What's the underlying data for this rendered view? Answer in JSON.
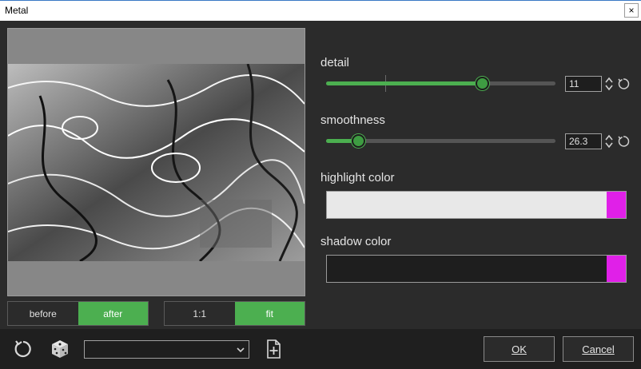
{
  "window": {
    "title": "Metal",
    "close_glyph": "×"
  },
  "preview": {
    "view_toggle": [
      {
        "label": "before",
        "active": false
      },
      {
        "label": "after",
        "active": true
      }
    ],
    "zoom_toggle": [
      {
        "label": "1:1",
        "active": false
      },
      {
        "label": "fit",
        "active": true
      }
    ]
  },
  "params": {
    "detail": {
      "label": "detail",
      "value": "11",
      "fraction": 0.68
    },
    "smoothness": {
      "label": "smoothness",
      "value": "26.3",
      "fraction": 0.14
    },
    "highlight": {
      "label": "highlight color",
      "color": "#e8e8e8",
      "picker": "#e020e8"
    },
    "shadow": {
      "label": "shadow color",
      "color": "#1e1e1e",
      "picker": "#e020e8"
    }
  },
  "footer": {
    "preset_value": "",
    "ok_label": "OK",
    "cancel_label": "Cancel",
    "icons": [
      "reset-icon",
      "dice-icon",
      "add-preset-icon"
    ]
  },
  "colors": {
    "accent": "#4caf50",
    "panel": "#2b2b2b",
    "footer": "#1f1f1f"
  }
}
